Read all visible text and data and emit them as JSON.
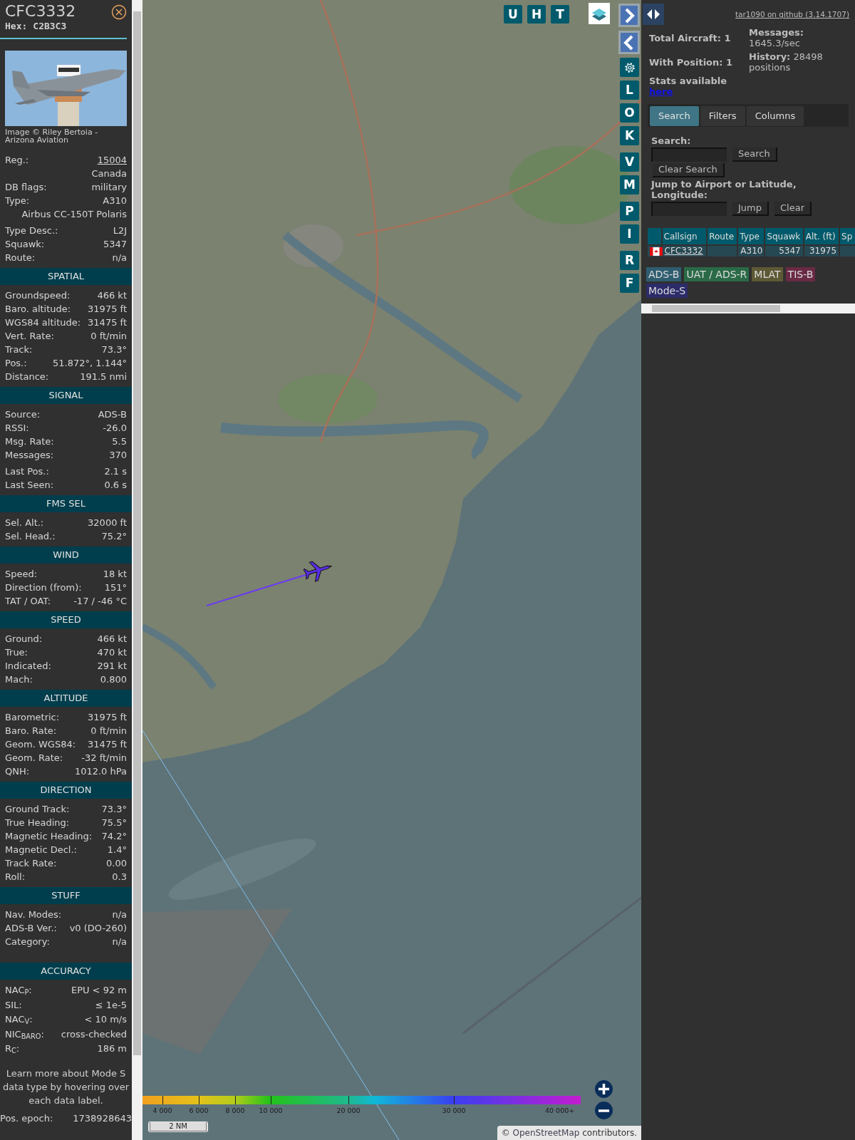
{
  "aircraft_panel": {
    "callsign": "CFC3332",
    "hex_label": "Hex:",
    "hex": "C2B3C3",
    "photo": {
      "kind": "picture"
    },
    "photo_credit": "Image © Riley Bertoia - Arizona Aviation",
    "details": {
      "groups": [
        [
          {
            "label": "Reg.:",
            "value": "15004",
            "link": true
          },
          {
            "value": "Canada"
          },
          {
            "label": "DB flags:",
            "value": "military"
          },
          {
            "label": "Type:",
            "value": "A310"
          },
          {
            "value": "Airbus CC-150T Polaris"
          }
        ],
        [
          {
            "label": "Type Desc.:",
            "value": "L2J"
          },
          {
            "label": "Squawk:",
            "value": "5347"
          },
          {
            "label": "Route:",
            "value": "n/a"
          }
        ]
      ]
    },
    "sections": [
      {
        "title": "SPATIAL",
        "groups": [
          [
            {
              "label": "Groundspeed:",
              "value": "466 kt"
            },
            {
              "label": "Baro. altitude:",
              "value": "31975 ft"
            },
            {
              "label": "WGS84 altitude:",
              "value": "31475 ft"
            },
            {
              "label": "Vert. Rate:",
              "value": "0 ft/min"
            },
            {
              "label": "Track:",
              "value": "73.3°"
            },
            {
              "label": "Pos.:",
              "value": "51.872°, 1.144°"
            },
            {
              "label": "Distance:",
              "value": "191.5 nmi"
            }
          ]
        ]
      },
      {
        "title": "SIGNAL",
        "groups": [
          [
            {
              "label": "Source:",
              "value": "ADS-B"
            },
            {
              "label": "RSSI:",
              "value": "-26.0"
            },
            {
              "label": "Msg. Rate:",
              "value": "5.5"
            },
            {
              "label": "Messages:",
              "value": "370"
            }
          ],
          [
            {
              "label": "Last Pos.:",
              "value": "2.1 s"
            },
            {
              "label": "Last Seen:",
              "value": "0.6 s"
            }
          ]
        ]
      },
      {
        "title": "FMS SEL",
        "groups": [
          [
            {
              "label": "Sel. Alt.:",
              "value": "32000 ft"
            },
            {
              "label": "Sel. Head.:",
              "value": "75.2°"
            }
          ]
        ]
      },
      {
        "title": "WIND",
        "groups": [
          [
            {
              "label": "Speed:",
              "value": "18 kt"
            },
            {
              "label": "Direction (from):",
              "value": "151°"
            },
            {
              "label": "TAT / OAT:",
              "value": "-17 / -46 °C"
            }
          ]
        ]
      },
      {
        "title": "SPEED",
        "groups": [
          [
            {
              "label": "Ground:",
              "value": "466 kt"
            },
            {
              "label": "True:",
              "value": "470 kt"
            },
            {
              "label": "Indicated:",
              "value": "291 kt"
            },
            {
              "label": "Mach:",
              "value": "0.800"
            }
          ]
        ]
      },
      {
        "title": "ALTITUDE",
        "groups": [
          [
            {
              "label": "Barometric:",
              "value": "31975 ft"
            },
            {
              "label": "Baro. Rate:",
              "value": "0 ft/min"
            },
            {
              "label": "Geom. WGS84:",
              "value": "31475 ft"
            },
            {
              "label": "Geom. Rate:",
              "value": "-32 ft/min"
            },
            {
              "label": "QNH:",
              "value": "1012.0 hPa"
            }
          ]
        ]
      },
      {
        "title": "DIRECTION",
        "groups": [
          [
            {
              "label": "Ground Track:",
              "value": "73.3°"
            },
            {
              "label": "True Heading:",
              "value": "75.5°"
            },
            {
              "label": "Magnetic Heading:",
              "value": "74.2°"
            },
            {
              "label": "Magnetic Decl.:",
              "value": "1.4°"
            },
            {
              "label": "Track Rate:",
              "value": "0.00"
            },
            {
              "label": "Roll:",
              "value": "0.3"
            }
          ]
        ]
      },
      {
        "title": "STUFF",
        "groups": [
          [
            {
              "label": "Nav. Modes:",
              "value": "n/a"
            },
            {
              "label": "ADS-B Ver.:",
              "value": "v0 (DO-260)"
            },
            {
              "label": "Category:",
              "value": "n/a"
            }
          ]
        ]
      },
      {
        "title": "ACCURACY",
        "groups": [
          [
            {
              "label": "NAC$_{P}$:",
              "value": "EPU < 92 m"
            },
            {
              "label": "SIL:",
              "value": "≤ 1e-5"
            },
            {
              "label": "NAC$_{V}$:",
              "value": "< 10 m/s"
            },
            {
              "label": "NIC$_{BARO}$:",
              "value": "cross-checked"
            },
            {
              "label": "R$_{C}$:",
              "value": "186 m"
            }
          ]
        ]
      }
    ],
    "note": "Learn more about Mode S data type by hovering over each data label.",
    "footer_rows": [
      {
        "label": "Pos. epoch:",
        "value": "1738928643"
      }
    ]
  },
  "map": {
    "picture": {
      "kind": "picture"
    },
    "top_buttons": [
      {
        "label": "U"
      },
      {
        "label": "H"
      },
      {
        "label": "T"
      }
    ],
    "side_buttons": [
      [
        {
          "kind": "next"
        },
        {
          "kind": "previous"
        },
        {
          "kind": "settings"
        },
        {
          "kind": "letter",
          "label": "L"
        },
        {
          "kind": "letter",
          "label": "O"
        },
        {
          "kind": "letter",
          "label": "K"
        }
      ],
      [
        {
          "kind": "letter",
          "label": "V"
        },
        {
          "kind": "letter",
          "label": "M"
        }
      ],
      [
        {
          "kind": "letter",
          "label": "P"
        },
        {
          "kind": "letter",
          "label": "I"
        }
      ],
      [
        {
          "kind": "letter",
          "label": "R"
        },
        {
          "kind": "letter",
          "label": "F"
        }
      ]
    ],
    "altitude_legend": [
      "4 000",
      "6 000",
      "8 000",
      "10 000",
      "20 000",
      "30 000",
      "40 000+"
    ],
    "scale": "2 NM",
    "attribution": {
      "prefix": "©",
      "link": "OpenStreetMap",
      "suffix": "contributors."
    }
  },
  "sidebar": {
    "github_link": "tar1090 on github (3.14.1707)",
    "stats_left": [
      "Total Aircraft: 1",
      "With Position: 1"
    ],
    "stats_note": {
      "text": "Stats available",
      "link": "here"
    },
    "stats_right": [
      "**Messages:** 1645.3/sec",
      "**History:** 28498 positions"
    ],
    "tabs": [
      {
        "label": "Search",
        "selected": true
      },
      {
        "label": "Filters",
        "selected": false
      },
      {
        "label": "Columns",
        "selected": false
      }
    ],
    "search": {
      "label": "Search:",
      "buttons": [
        "Search",
        "Clear Search"
      ]
    },
    "jump": {
      "label": "Jump to Airport or Latitude, Longitude:",
      "buttons": [
        "Jump",
        "Clear"
      ]
    },
    "table": {
      "columns": [
        "Callsign",
        "Route",
        "Type",
        "Squawk",
        "Alt. (ft)",
        "Sp"
      ],
      "rows": [
        {
          "callsign": "CFC3332",
          "type": "A310",
          "squawk": "5347",
          "altitude": "31975"
        }
      ]
    },
    "sources": [
      {
        "label": "ADS-B",
        "color": "#2f5d70"
      },
      {
        "label": "UAT / ADS-R",
        "color": "#2a6a47"
      },
      {
        "label": "MLAT",
        "color": "#5e5935"
      },
      {
        "label": "TIS-B",
        "color": "#6a2a45"
      },
      {
        "label": "Mode-S",
        "color": "#2c2c6a"
      }
    ]
  }
}
